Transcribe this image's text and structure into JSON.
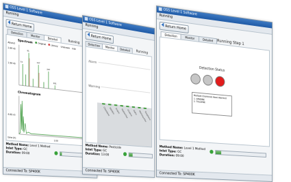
{
  "app": {
    "title": "OSS Level 1 Software",
    "status": "Running",
    "return_label": "Return Home",
    "connected": "Connected To: SP400K"
  },
  "method": {
    "name_label": "Method Name:",
    "inlet_label": "Inlet Type:",
    "duration_label": "Duration:",
    "win1_name": "Level 1 Method",
    "win1_inlet": "GC",
    "win1_duration": "09:00",
    "win2_name": "Pesticide",
    "win2_inlet": "GC",
    "win2_duration": "13:00",
    "win3_name": "Level 1 Method",
    "win3_inlet": "GC",
    "win3_duration": "09:00"
  },
  "tabs": [
    "Detection",
    "Monitor",
    "Detailed"
  ],
  "window1": {
    "running": "Running",
    "spectrum_title": "Spectrum",
    "legend": [
      "Original",
      "Library",
      "Unknown",
      "Inte"
    ],
    "y_axis_label": "Abund",
    "y_ticks": [
      "2.0E+6",
      "1.5E+6",
      "4.0E+5"
    ],
    "peak_labels": [
      "73",
      "91",
      "147",
      "207",
      "281"
    ],
    "chromatogram_title": "Chromatogram",
    "x_label": "time (h)",
    "x_ticks": [
      "1:00"
    ],
    "progress_fraction": 0.05
  },
  "window2": {
    "running": "Running",
    "alarm_label": "Alarm",
    "warning_label": "Warning",
    "compounds": [
      "Chlordane",
      "Dieldrin",
      "Endrin",
      "Heptachlor",
      "Lindane",
      "Aldrin",
      "Methoxychlor",
      "Toxaphene"
    ],
    "progress_fraction": 0.15
  },
  "window3": {
    "running": "Running Step 1",
    "status_title": "Detection Status",
    "lights": [
      "#c6c6c6",
      "#c6c6c6",
      "#e21c1c"
    ],
    "message": [
      "Multiple Chemicals Have Alarmed",
      "1. SPADINE",
      "2. TOLUENE"
    ],
    "progress_fraction": 0.1,
    "alarm_badge": "Alarm"
  }
}
